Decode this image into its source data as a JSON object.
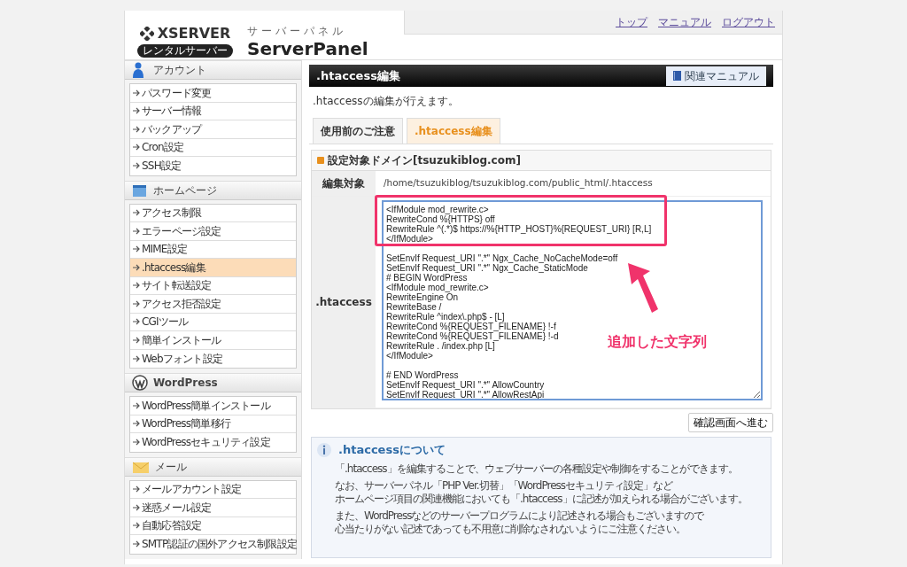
{
  "header": {
    "logo_text": "XSERVER",
    "logo_badge": "レンタルサーバー",
    "subtitle": "サーバーパネル",
    "title": "ServerPanel",
    "links": [
      "トップ",
      "マニュアル",
      "ログアウト"
    ]
  },
  "sidebar": [
    {
      "title": "アカウント",
      "items": [
        {
          "label": "パスワード変更",
          "selected": false
        },
        {
          "label": "サーバー情報",
          "selected": false
        },
        {
          "label": "バックアップ",
          "selected": false
        },
        {
          "label": "Cron設定",
          "selected": false
        },
        {
          "label": "SSH設定",
          "selected": false
        }
      ]
    },
    {
      "title": "ホームページ",
      "items": [
        {
          "label": "アクセス制限",
          "selected": false
        },
        {
          "label": "エラーページ設定",
          "selected": false
        },
        {
          "label": "MIME設定",
          "selected": false
        },
        {
          "label": ".htaccess編集",
          "selected": true
        },
        {
          "label": "サイト転送設定",
          "selected": false
        },
        {
          "label": "アクセス拒否設定",
          "selected": false
        },
        {
          "label": "CGIツール",
          "selected": false
        },
        {
          "label": "簡単インストール",
          "selected": false
        },
        {
          "label": "Webフォント設定",
          "selected": false
        }
      ]
    },
    {
      "title": "WordPress",
      "items": [
        {
          "label": "WordPress簡単インストール",
          "selected": false
        },
        {
          "label": "WordPress簡単移行",
          "selected": false
        },
        {
          "label": "WordPressセキュリティ設定",
          "selected": false
        }
      ]
    },
    {
      "title": "メール",
      "items": [
        {
          "label": "メールアカウント設定",
          "selected": false
        },
        {
          "label": "迷惑メール設定",
          "selected": false
        },
        {
          "label": "自動応答設定",
          "selected": false
        },
        {
          "label": "SMTP認証の国外アクセス制限設定",
          "selected": false
        }
      ]
    }
  ],
  "main": {
    "title": ".htaccess編集",
    "manual_button": "関連マニュアル",
    "description": ".htaccessの編集が行えます。",
    "tabs": [
      {
        "label": "使用前のご注意",
        "selected": false
      },
      {
        "label": ".htaccess編集",
        "selected": true
      }
    ],
    "domain_heading": "設定対象ドメイン[tsuzukiblog.com]",
    "rows": [
      {
        "label": "編集対象",
        "kind": "text",
        "value": "/home/tsuzukiblog/tsuzukiblog.com/public_html/.htaccess"
      },
      {
        "label": ".htaccess",
        "kind": "editor",
        "blocks": [
          [
            "<IfModule mod_rewrite.c>",
            "RewriteCond %{HTTPS} off",
            "RewriteRule ^(.*)$ https://%{HTTP_HOST}%{REQUEST_URI} [R,L]",
            "</IfModule>"
          ],
          [
            "SetEnvIf Request_URI \".*\" Ngx_Cache_NoCacheMode=off",
            "SetEnvIf Request_URI \".*\" Ngx_Cache_StaticMode",
            "# BEGIN WordPress",
            "<IfModule mod_rewrite.c>",
            "RewriteEngine On",
            "RewriteBase /",
            "RewriteRule ^index\\.php$ - [L]",
            "RewriteCond %{REQUEST_FILENAME} !-f",
            "RewriteCond %{REQUEST_FILENAME} !-d",
            "RewriteRule . /index.php [L]",
            "</IfModule>"
          ],
          [
            "# END WordPress",
            "SetEnvIf Request_URI \".*\" AllowCountry",
            "SetEnvIf Request_URI \".*\" AllowRestApi"
          ]
        ]
      }
    ],
    "annotation": {
      "label": "追加した文字列"
    },
    "confirm_button": "確認画面へ進む",
    "info": {
      "title": ".htaccessについて",
      "paragraphs": [
        [
          "「.htaccess」を編集することで、ウェブサーバーの各種設定や制御をすることができます。"
        ],
        [
          "なお、サーバーパネル「PHP Ver.切替」「WordPressセキュリティ設定」など",
          "ホームページ項目の関連機能においても「.htaccess」に記述が加えられる場合がございます。"
        ],
        [
          "また、WordPressなどのサーバープログラムにより記述される場合もございますので",
          "心当たりがない記述であっても不用意に削除なされないようにご注意ください。"
        ]
      ]
    }
  }
}
